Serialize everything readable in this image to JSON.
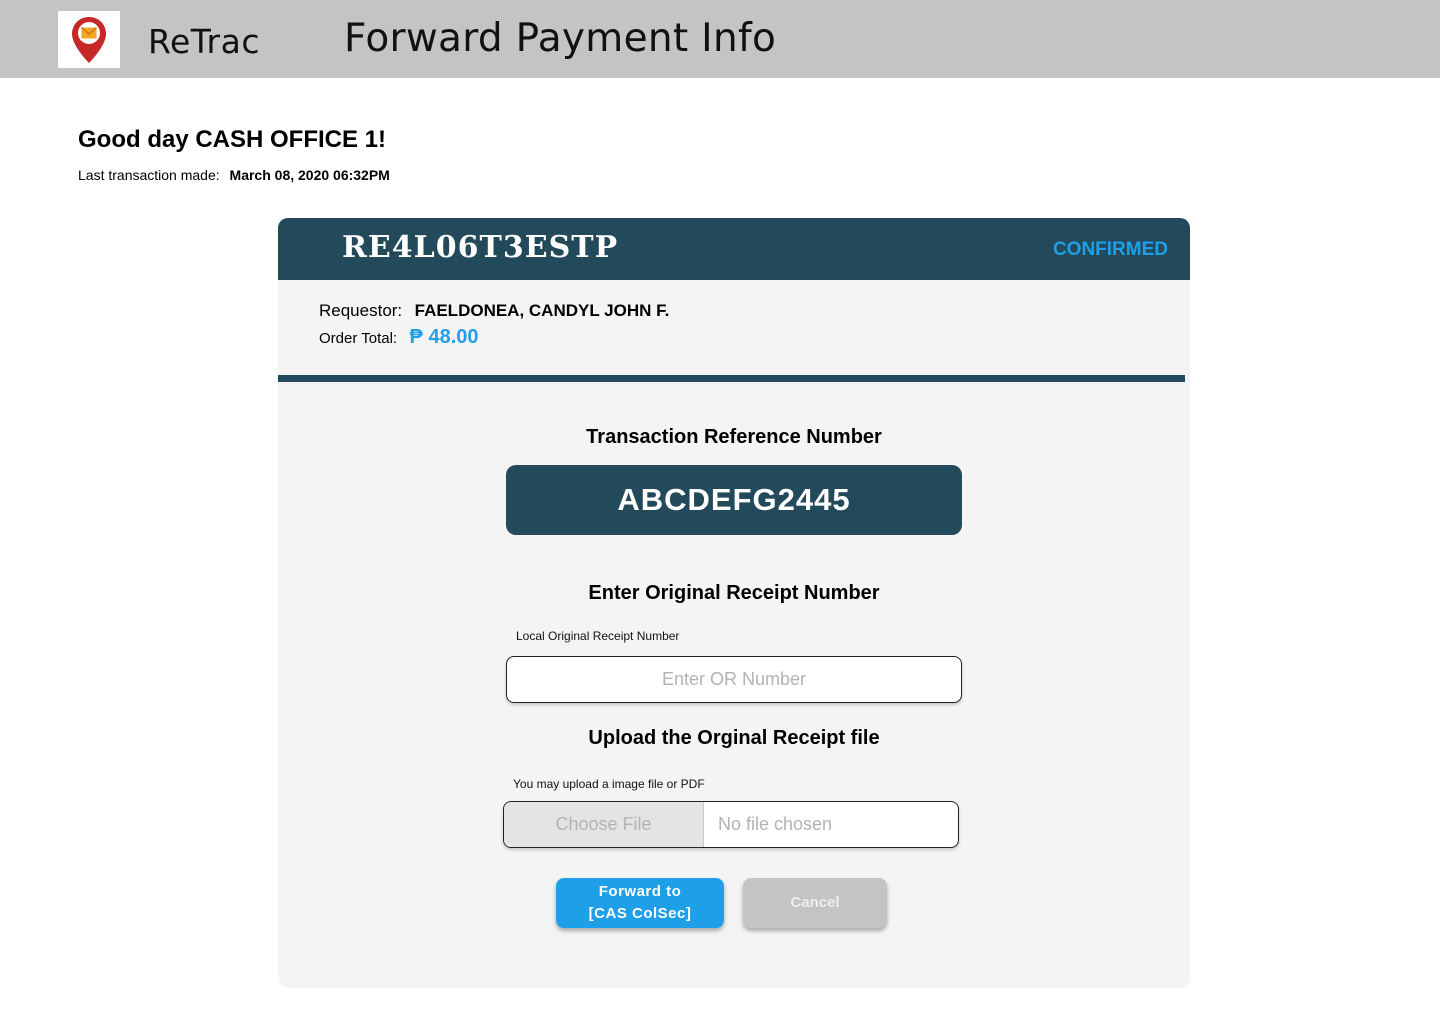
{
  "header": {
    "app_name": "ReTrac",
    "page_title": "Forward Payment Info",
    "logo_icon": "map-pin-envelope-icon",
    "logo_colors": {
      "pin": "#c62828",
      "envelope": "#f5a623"
    }
  },
  "greeting": {
    "text": "Good day CASH OFFICE 1!",
    "last_transaction_label": "Last transaction made:",
    "last_transaction_value": "March 08, 2020 06:32PM"
  },
  "card": {
    "code": "RE4L06T3ESTP",
    "status": "CONFIRMED",
    "requestor_label": "Requestor:",
    "requestor_value": "FAELDONEA, CANDYL JOHN F.",
    "order_total_label": "Order Total:",
    "order_total_value": "₱ 48.00",
    "transaction_ref_title": "Transaction Reference Number",
    "transaction_ref_value": "ABCDEFG2445",
    "or_title": "Enter Original Receipt Number",
    "or_field_label": "Local Original Receipt Number",
    "or_placeholder": "Enter OR Number",
    "upload_title": "Upload the Orginal Receipt file",
    "upload_hint": "You may upload a image file or PDF",
    "choose_file_label": "Choose File",
    "no_file_label": "No file chosen",
    "forward_line1": "Forward to",
    "forward_line2": "[CAS ColSec]",
    "cancel_label": "Cancel"
  },
  "colors": {
    "topbar": "#c4c4c4",
    "primary_dark": "#234a5b",
    "accent_blue": "#1e9fe8",
    "card_bg": "#f4f4f4",
    "cancel_gray": "#c4c4c4"
  }
}
